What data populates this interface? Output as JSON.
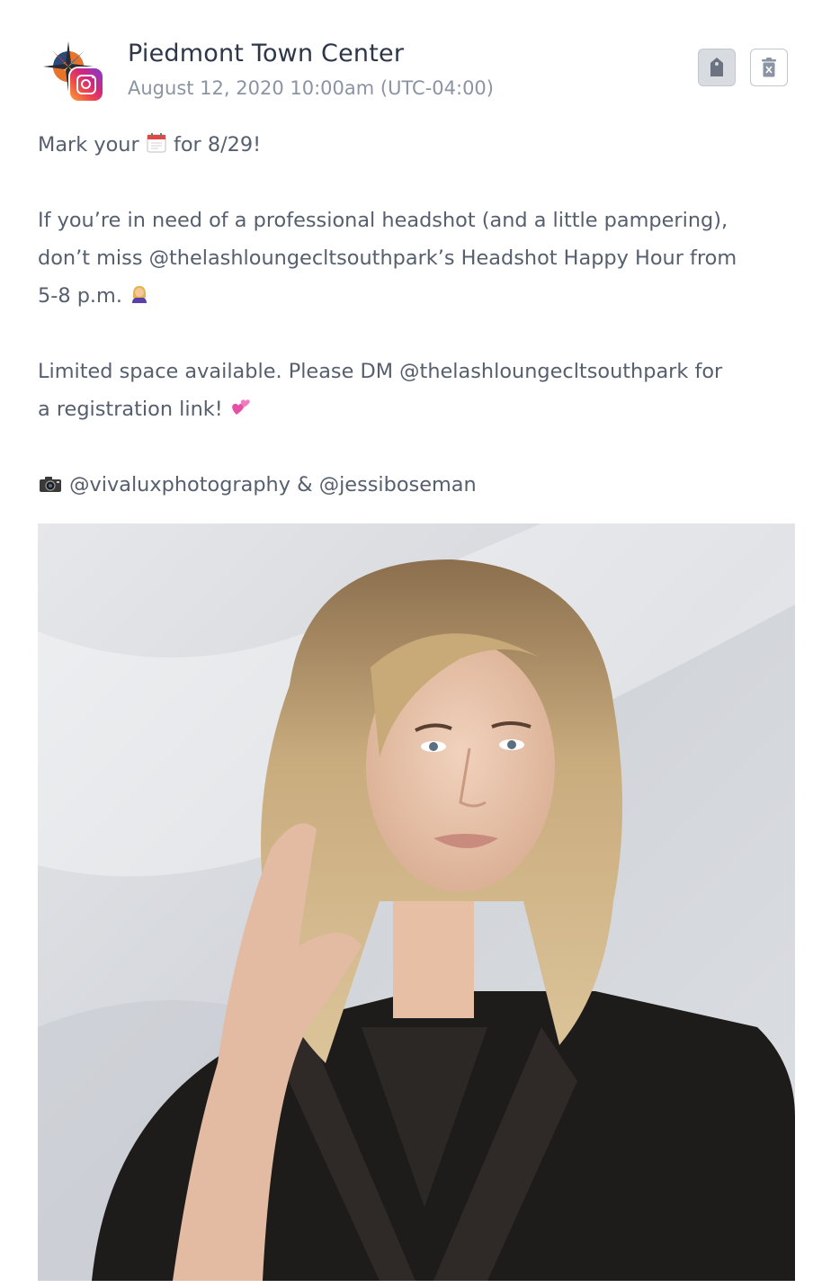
{
  "post": {
    "account_name": "Piedmont Town Center",
    "date": "August 12, 2020 10:00am (UTC-04:00)",
    "network_icon": "instagram-icon",
    "caption": {
      "line1_prefix": "Mark your",
      "line1_suffix": "for 8/29!",
      "line2": "If you’re in need of a professional headshot (and a little pampering),",
      "line3": "don’t miss @thelashloungecltsouthpark’s Headshot Happy Hour from",
      "line4": "5-8 p.m.",
      "line5": "Limited space available. Please DM @thelashloungecltsouthpark for",
      "line6": "a registration link!",
      "line7": "@vivaluxphotography & @jessiboseman"
    },
    "emojis": {
      "calendar": "calendar-icon",
      "woman": "woman-icon",
      "hearts": "revolving-hearts-icon",
      "camera": "camera-icon"
    },
    "buttons": {
      "tag_icon": "tag-icon",
      "delete_icon": "trash-icon"
    },
    "photo": {
      "subject": "blonde woman in black blazer, hand raised to hair, grey fabric backdrop"
    }
  }
}
